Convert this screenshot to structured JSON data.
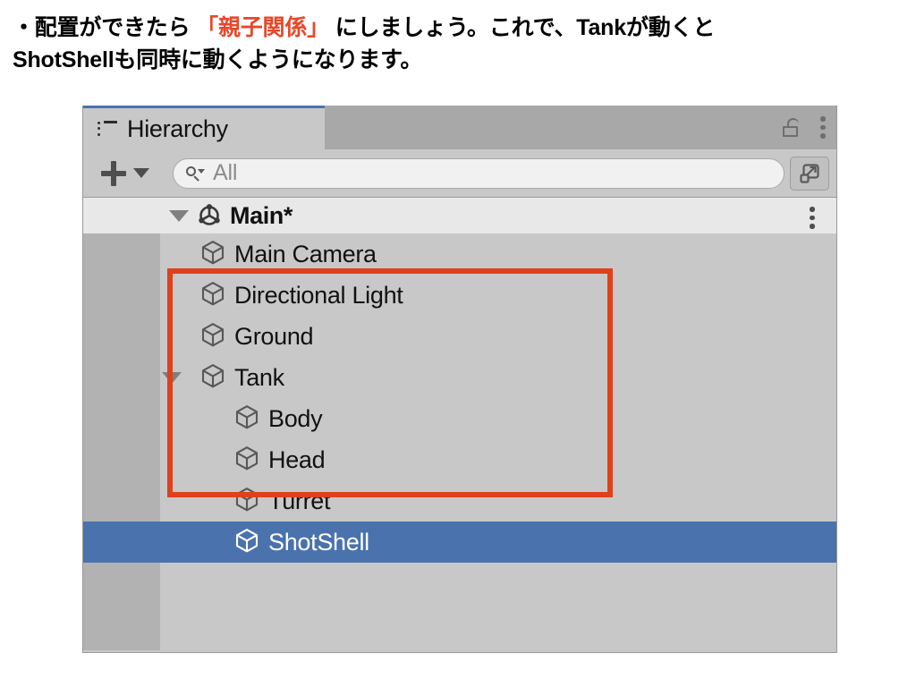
{
  "caption": {
    "line1_pre": "・配置ができたら ",
    "line1_red": "「親子関係」",
    "line1_post": " にしましょう。これで、Tankが動くと",
    "line2": "ShotShellも同時に動くようになります。",
    "red_color": "#e8472a"
  },
  "panel": {
    "tab": {
      "label": "Hierarchy",
      "icon": "list-icon",
      "accent_color": "#4a72ad"
    },
    "tools": {
      "lock_icon": "lock-open-icon",
      "menu_icon": "kebab-menu-icon"
    },
    "toolbar": {
      "add_label": "+",
      "add_dropdown_icon": "chevron-down-icon",
      "search_icon": "search-icon",
      "search_value": "All",
      "search_placeholder": "All",
      "expand_icon": "open-in-new-window-icon"
    },
    "scene_row": {
      "name": "Main*",
      "expanded": true,
      "icon": "unity-scene-icon",
      "menu_icon": "kebab-menu-icon"
    },
    "tree": [
      {
        "name": "Main Camera",
        "depth": 1,
        "icon": "gameobject-cube-icon",
        "expandable": false,
        "selected": false
      },
      {
        "name": "Directional Light",
        "depth": 1,
        "icon": "gameobject-cube-icon",
        "expandable": false,
        "selected": false
      },
      {
        "name": "Ground",
        "depth": 1,
        "icon": "gameobject-cube-icon",
        "expandable": false,
        "selected": false
      },
      {
        "name": "Tank",
        "depth": 1,
        "icon": "gameobject-cube-icon",
        "expandable": true,
        "expanded": true,
        "selected": false
      },
      {
        "name": "Body",
        "depth": 2,
        "icon": "gameobject-cube-icon",
        "expandable": false,
        "selected": false
      },
      {
        "name": "Head",
        "depth": 2,
        "icon": "gameobject-cube-icon",
        "expandable": false,
        "selected": false
      },
      {
        "name": "Turret",
        "depth": 2,
        "icon": "gameobject-cube-icon",
        "expandable": false,
        "selected": false
      },
      {
        "name": "ShotShell",
        "depth": 2,
        "icon": "gameobject-cube-icon",
        "expandable": false,
        "selected": true
      }
    ],
    "selection_color": "#4a72ad",
    "annotation": {
      "type": "rectangle",
      "color": "#e0401c",
      "covers": "Tank and its children"
    }
  }
}
